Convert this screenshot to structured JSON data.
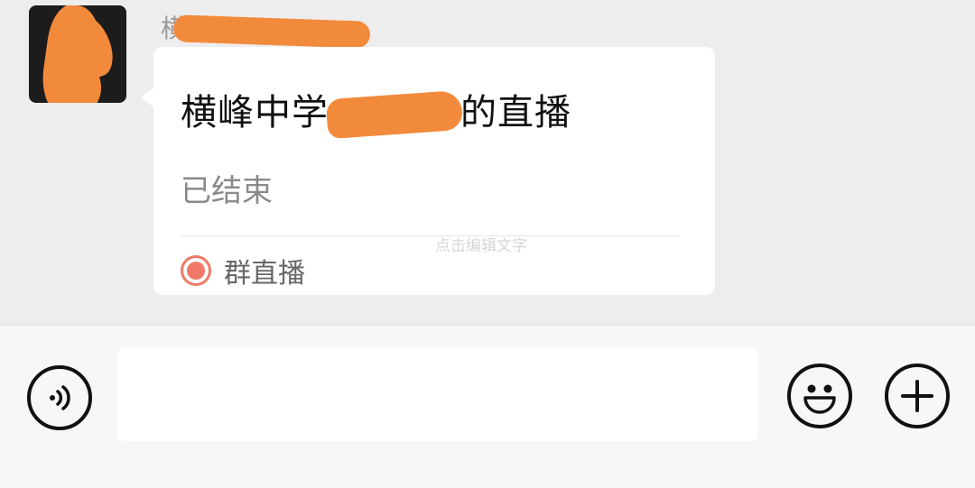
{
  "chat": {
    "sender_name": "横峰",
    "card": {
      "title_prefix": "横峰中学",
      "title_suffix": "的直播",
      "status": "已结束",
      "footer_label": "群直播",
      "footer_icon": "live-record-icon"
    },
    "hint": "点击编辑文字"
  },
  "input_bar": {
    "voice_icon": "voice-icon",
    "emoji_icon": "emoji-icon",
    "plus_icon": "plus-icon",
    "input_value": ""
  },
  "colors": {
    "background": "#ededed",
    "card": "#ffffff",
    "live_accent": "#f07a67",
    "redaction": "#f28a3c"
  }
}
